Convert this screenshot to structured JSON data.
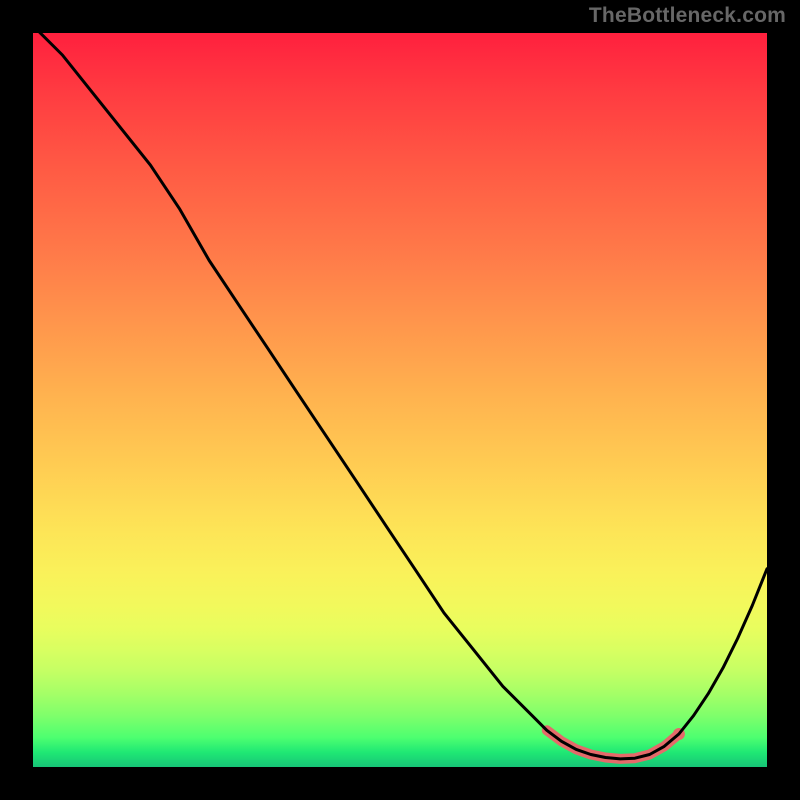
{
  "watermark": "TheBottleneck.com",
  "chart_data": {
    "type": "line",
    "title": "",
    "xlabel": "",
    "ylabel": "",
    "xlim": [
      0,
      100
    ],
    "ylim": [
      0,
      100
    ],
    "series": [
      {
        "name": "curve",
        "color": "#000000",
        "stroke_width": 3,
        "x": [
          0,
          4,
          8,
          12,
          16,
          20,
          24,
          28,
          32,
          36,
          40,
          44,
          48,
          52,
          56,
          60,
          64,
          68,
          70,
          72,
          74,
          76,
          78,
          80,
          82,
          84,
          86,
          88,
          90,
          92,
          94,
          96,
          98,
          100
        ],
        "y": [
          101,
          97,
          92,
          87,
          82,
          76,
          69,
          63,
          57,
          51,
          45,
          39,
          33,
          27,
          21,
          16,
          11,
          7,
          5,
          3.5,
          2.4,
          1.7,
          1.3,
          1.1,
          1.2,
          1.7,
          2.8,
          4.5,
          7.0,
          10.0,
          13.5,
          17.5,
          22.0,
          27.0
        ]
      }
    ],
    "highlight": {
      "name": "minimum-region",
      "color": "#e46a6a",
      "stroke_width": 10,
      "x": [
        70,
        72,
        74,
        76,
        78,
        80,
        82,
        84,
        86,
        88
      ],
      "y": [
        5.0,
        3.5,
        2.4,
        1.7,
        1.3,
        1.1,
        1.2,
        1.7,
        2.8,
        4.5
      ],
      "end_dot": {
        "x": 88,
        "y": 4.5,
        "r": 6
      }
    },
    "background_gradient": {
      "top": "#ff203e",
      "bottom": "#17c477"
    }
  }
}
